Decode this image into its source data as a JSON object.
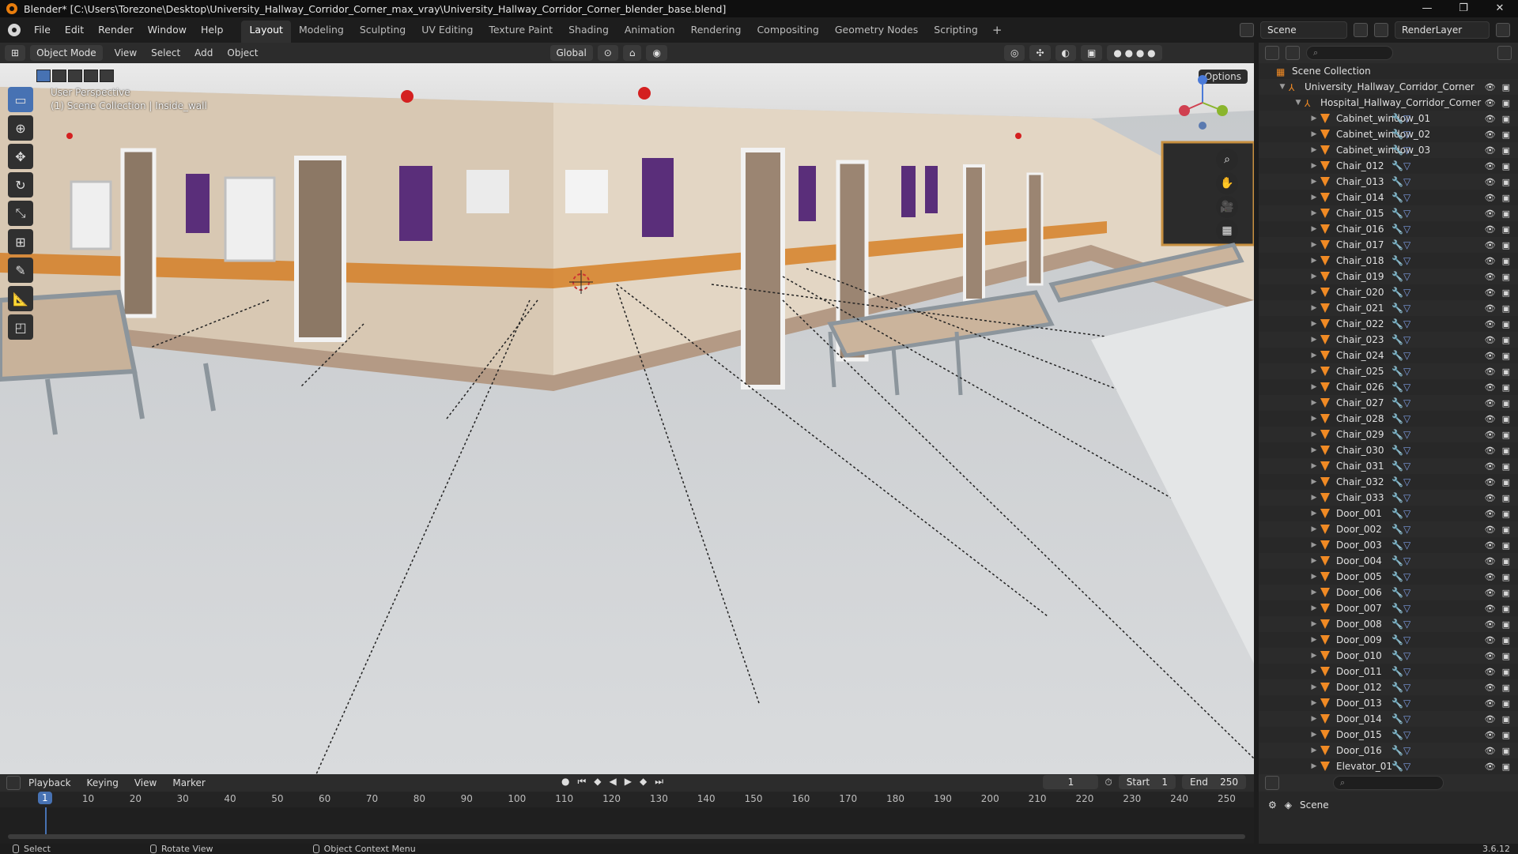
{
  "window": {
    "title": "Blender* [C:\\Users\\Torezone\\Desktop\\University_Hallway_Corridor_Corner_max_vray\\University_Hallway_Corridor_Corner_blender_base.blend]",
    "controls": [
      "—",
      "❐",
      "✕"
    ]
  },
  "menu": {
    "items": [
      "File",
      "Edit",
      "Render",
      "Window",
      "Help"
    ],
    "workspaces": [
      "Layout",
      "Modeling",
      "Sculpting",
      "UV Editing",
      "Texture Paint",
      "Shading",
      "Animation",
      "Rendering",
      "Compositing",
      "Geometry Nodes",
      "Scripting"
    ],
    "active_workspace": "Layout",
    "add_workspace": "+",
    "scene": "Scene",
    "view_layer": "RenderLayer"
  },
  "viewport_header": {
    "mode": "Object Mode",
    "menus": [
      "View",
      "Select",
      "Add",
      "Object"
    ],
    "transform_orientation": "Global",
    "options": "Options"
  },
  "viewport": {
    "perspective": "User Perspective",
    "context": "(1) Scene Collection | Inside_wall",
    "tools": [
      "select-box",
      "cursor",
      "move",
      "rotate",
      "scale",
      "transform",
      "annotate",
      "measure",
      "add-cube"
    ]
  },
  "outliner": {
    "root": "Scene Collection",
    "collections": [
      "University_Hallway_Corridor_Corner",
      "Hospital_Hallway_Corridor_Corner"
    ],
    "objects": [
      "Cabinet_window_01",
      "Cabinet_window_02",
      "Cabinet_window_03",
      "Chair_012",
      "Chair_013",
      "Chair_014",
      "Chair_015",
      "Chair_016",
      "Chair_017",
      "Chair_018",
      "Chair_019",
      "Chair_020",
      "Chair_021",
      "Chair_022",
      "Chair_023",
      "Chair_024",
      "Chair_025",
      "Chair_026",
      "Chair_027",
      "Chair_028",
      "Chair_029",
      "Chair_030",
      "Chair_031",
      "Chair_032",
      "Chair_033",
      "Door_001",
      "Door_002",
      "Door_003",
      "Door_004",
      "Door_005",
      "Door_006",
      "Door_007",
      "Door_008",
      "Door_009",
      "Door_010",
      "Door_011",
      "Door_012",
      "Door_013",
      "Door_014",
      "Door_015",
      "Door_016",
      "Elevator_01"
    ]
  },
  "timeline": {
    "menus": [
      "Playback",
      "Keying",
      "View",
      "Marker"
    ],
    "current_frame": "1",
    "start_label": "Start",
    "start": "1",
    "end_label": "End",
    "end": "250",
    "ruler": [
      "10",
      "20",
      "30",
      "40",
      "50",
      "60",
      "70",
      "80",
      "90",
      "100",
      "110",
      "120",
      "130",
      "140",
      "150",
      "160",
      "170",
      "180",
      "190",
      "200",
      "210",
      "220",
      "230",
      "240",
      "250"
    ]
  },
  "properties": {
    "scene_label": "Scene"
  },
  "statusbar": {
    "items": [
      "Select",
      "Rotate View",
      "Object Context Menu"
    ],
    "version": "3.6.12"
  }
}
